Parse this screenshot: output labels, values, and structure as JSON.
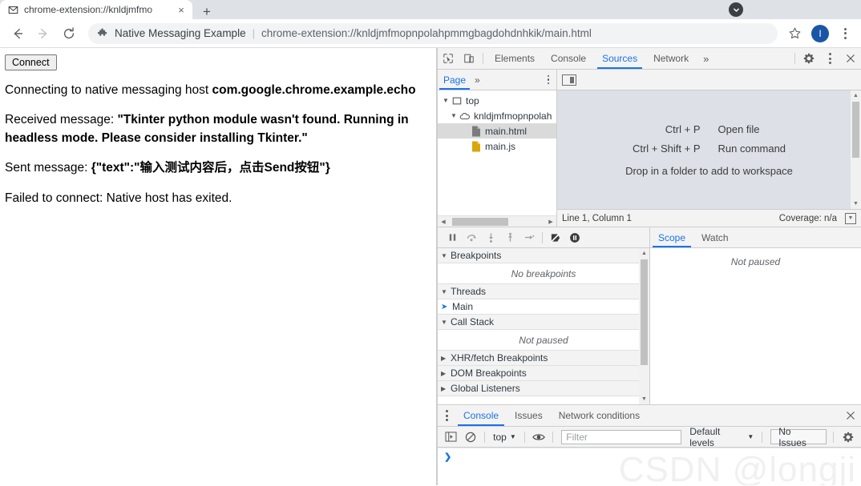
{
  "browser": {
    "tab": {
      "title": "chrome-extension://knldjmfmo",
      "favicon": "mail-icon",
      "close": "×"
    },
    "new_tab_label": "+",
    "tab_search": "chevron-down-icon",
    "nav": {
      "back": "back-arrow-icon",
      "forward": "forward-arrow-icon",
      "reload": "reload-icon"
    },
    "omnibox": {
      "extension_icon": "puzzle-piece-icon",
      "extension_name": "Native Messaging Example",
      "separator": "|",
      "url": "chrome-extension://knldjmfmopnpolahpmmgbagdohdnhkik/main.html"
    },
    "bookmark_icon": "star-icon",
    "avatar_label": "I",
    "menu_icon": "three-dot-menu-icon"
  },
  "page": {
    "connect_button": "Connect",
    "lines": [
      {
        "text": "Connecting to native messaging host ",
        "bold": "com.google.chrome.example.echo"
      },
      {
        "text": "Received message: ",
        "bold": "\"Tkinter python module wasn't found. Running in headless mode. Please consider installing Tkinter.\""
      },
      {
        "text": "Sent message: ",
        "bold": "{\"text\":\"输入测试内容后，点击Send按钮\"}"
      },
      {
        "text": "Failed to connect: Native host has exited.",
        "bold": ""
      }
    ]
  },
  "devtools": {
    "inspect_icon": "inspect-cursor-icon",
    "device_toolbar_icon": "device-toolbar-icon",
    "tabs": [
      {
        "label": "Elements",
        "active": false
      },
      {
        "label": "Console",
        "active": false
      },
      {
        "label": "Sources",
        "active": true
      },
      {
        "label": "Network",
        "active": false
      }
    ],
    "more_tabs": "»",
    "settings_icon": "gear-icon",
    "menu_icon": "three-dot-menu-icon",
    "close_icon": "close-icon",
    "navigator": {
      "tabs": [
        {
          "label": "Page",
          "active": true
        }
      ],
      "more_tabs": "»",
      "menu_icon": "three-dot-menu-icon",
      "tree": [
        {
          "label": "top",
          "depth": 0,
          "icon": "frame-icon",
          "twisty": "▼",
          "selected": false
        },
        {
          "label": "knldjmfmopnpolah",
          "depth": 1,
          "icon": "cloud-icon",
          "twisty": "▼",
          "selected": false
        },
        {
          "label": "main.html",
          "depth": 2,
          "icon": "document-icon",
          "twisty": "",
          "selected": true
        },
        {
          "label": "main.js",
          "depth": 2,
          "icon": "script-icon",
          "twisty": "",
          "selected": false
        }
      ]
    },
    "editor": {
      "panel_toggle_icon": "show-navigator-icon",
      "shortcuts": [
        {
          "keys": "Ctrl + P",
          "action": "Open file"
        },
        {
          "keys": "Ctrl + Shift + P",
          "action": "Run command"
        }
      ],
      "drop_hint": "Drop in a folder to add to workspace",
      "status_left": "Line 1, Column 1",
      "status_right": "Coverage: n/a",
      "coverage_icon": "coverage-drawer-icon"
    },
    "debugger": {
      "toolbar_icons": [
        "pause-icon",
        "step-over-icon",
        "step-into-icon",
        "step-out-icon",
        "step-icon",
        "deactivate-breakpoints-icon",
        "pause-on-exceptions-icon"
      ],
      "panes": [
        {
          "title": "Breakpoints",
          "expanded": true,
          "empty_text": "No breakpoints"
        },
        {
          "title": "Threads",
          "expanded": true,
          "rows": [
            "Main"
          ]
        },
        {
          "title": "Call Stack",
          "expanded": true,
          "empty_text": "Not paused"
        },
        {
          "title": "XHR/fetch Breakpoints",
          "expanded": false
        },
        {
          "title": "DOM Breakpoints",
          "expanded": false
        },
        {
          "title": "Global Listeners",
          "expanded": false
        }
      ],
      "scope_tabs": [
        {
          "label": "Scope",
          "active": true
        },
        {
          "label": "Watch",
          "active": false
        }
      ],
      "scope_empty": "Not paused"
    },
    "drawer": {
      "menu_icon": "three-dot-menu-icon",
      "tabs": [
        {
          "label": "Console",
          "active": true
        },
        {
          "label": "Issues",
          "active": false
        },
        {
          "label": "Network conditions",
          "active": false
        }
      ],
      "close_icon": "close-icon",
      "toolbar": {
        "sidebar_icon": "console-sidebar-icon",
        "clear_icon": "clear-console-icon",
        "context": "top",
        "context_caret": "▼",
        "eye_icon": "live-expression-icon",
        "filter_placeholder": "Filter",
        "levels": "Default levels",
        "levels_caret": "▼",
        "issues": "No Issues",
        "settings_icon": "gear-icon"
      },
      "prompt_caret": "❯"
    }
  },
  "watermark": "CSDN @longji",
  "colors": {
    "accent": "#1a73e8",
    "tabstrip": "#dee1e6",
    "devtools_bg": "#f3f3f3",
    "editor_bg": "#dde1e7",
    "avatar": "#1a56a5"
  }
}
